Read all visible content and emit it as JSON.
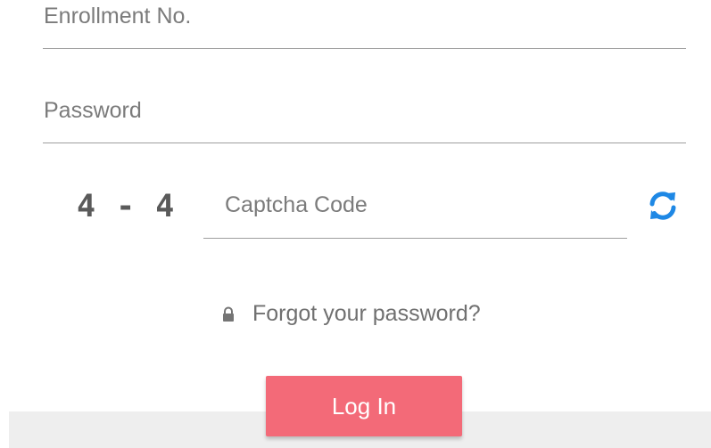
{
  "form": {
    "enrollment_placeholder": "Enrollment No.",
    "password_placeholder": "Password",
    "captcha_question": "4 - 4",
    "captcha_placeholder": "Captcha Code",
    "forgot_password": "Forgot your password?",
    "login_label": "Log In"
  },
  "icons": {
    "refresh": "refresh-icon",
    "lock": "lock-icon"
  },
  "colors": {
    "accent": "#f36a78",
    "refresh_icon": "#1e88e5",
    "footer": "#eeeeee"
  }
}
